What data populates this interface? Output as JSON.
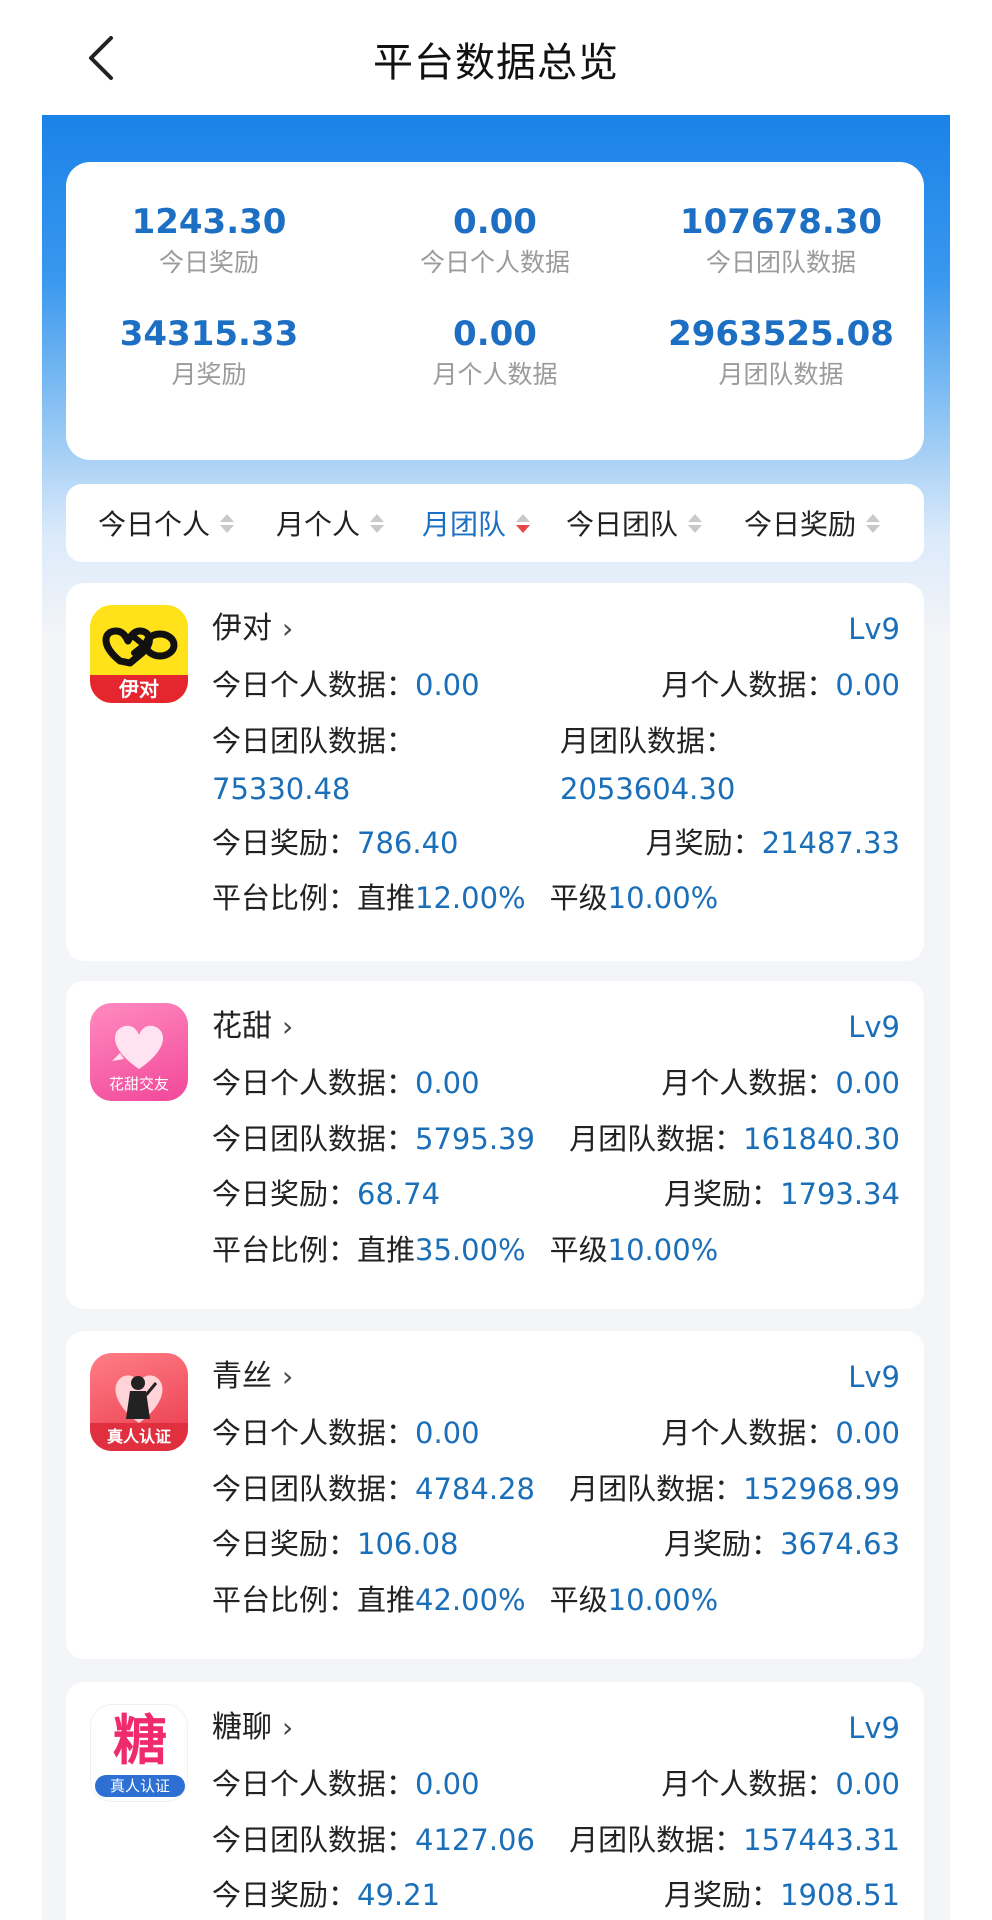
{
  "header": {
    "title": "平台数据总览",
    "back_icon": "chevron-left-icon"
  },
  "summary": [
    {
      "value": "1243.30",
      "label": "今日奖励"
    },
    {
      "value": "0.00",
      "label": "今日个人数据"
    },
    {
      "value": "107678.30",
      "label": "今日团队数据"
    },
    {
      "value": "34315.33",
      "label": "月奖励"
    },
    {
      "value": "0.00",
      "label": "月个人数据"
    },
    {
      "value": "2963525.08",
      "label": "月团队数据"
    }
  ],
  "sort_tabs": [
    {
      "label": "今日个人",
      "active": false
    },
    {
      "label": "月个人",
      "active": false
    },
    {
      "label": "月团队",
      "active": true
    },
    {
      "label": "今日团队",
      "active": false
    },
    {
      "label": "今日奖励",
      "active": false
    }
  ],
  "labels": {
    "today_personal": "今日个人数据：",
    "month_personal": "月个人数据：",
    "today_team": "今日团队数据：",
    "month_team": "月团队数据：",
    "today_team_colon": "今日团队数据：",
    "month_team_colon": "月团队数据：",
    "today_reward": "今日奖励：",
    "month_reward": "月奖励：",
    "ratio": "平台比例：",
    "direct": "直推",
    "peer": "平级"
  },
  "platforms": [
    {
      "name": "伊对",
      "level": "Lv9",
      "icon_text": "伊对",
      "today_personal": "0.00",
      "month_personal": "0.00",
      "today_team": "75330.48",
      "month_team": "2053604.30",
      "today_reward": "786.40",
      "month_reward": "21487.33",
      "direct": "12.00%",
      "peer": "10.00%"
    },
    {
      "name": "花甜",
      "level": "Lv9",
      "icon_text": "花甜交友",
      "today_personal": "0.00",
      "month_personal": "0.00",
      "today_team": "5795.39",
      "month_team": "161840.30",
      "today_reward": "68.74",
      "month_reward": "1793.34",
      "direct": "35.00%",
      "peer": "10.00%"
    },
    {
      "name": "青丝",
      "level": "Lv9",
      "icon_text": "真人认证",
      "today_personal": "0.00",
      "month_personal": "0.00",
      "today_team": "4784.28",
      "month_team": "152968.99",
      "today_reward": "106.08",
      "month_reward": "3674.63",
      "direct": "42.00%",
      "peer": "10.00%"
    },
    {
      "name": "糖聊",
      "level": "Lv9",
      "icon_text": "真人认证",
      "icon_glyph": "糖",
      "today_personal": "0.00",
      "month_personal": "0.00",
      "today_team": "4127.06",
      "month_team": "157443.31",
      "today_reward": "49.21",
      "month_reward": "1908.51"
    }
  ],
  "colors": {
    "accent": "#1c6fc2",
    "value": "#1b6fb8",
    "header_blue": "#1a83e8",
    "sort_active_arrow": "#e84545"
  }
}
